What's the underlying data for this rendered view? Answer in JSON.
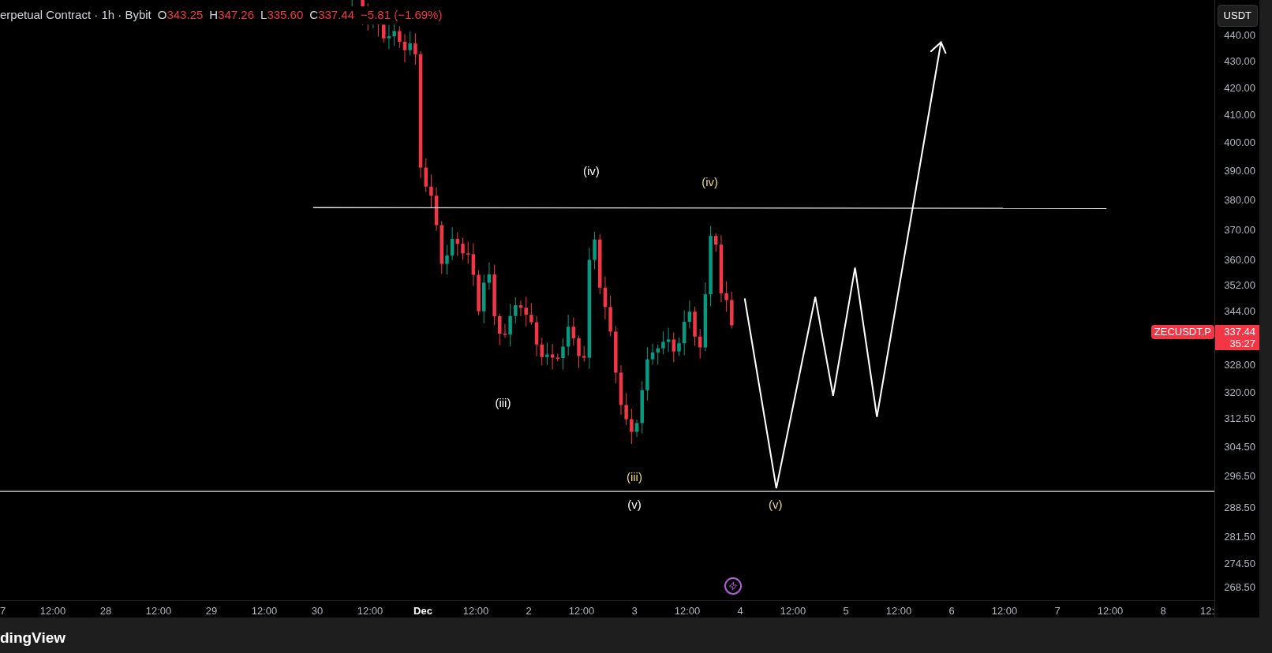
{
  "legend": {
    "symbol": "erpetual Contract · 1h · Bybit",
    "fields": [
      {
        "label": "O",
        "value": "343.25"
      },
      {
        "label": "H",
        "value": "347.26"
      },
      {
        "label": "L",
        "value": "335.60"
      },
      {
        "label": "C",
        "value": "337.44"
      }
    ],
    "change": "−5.81 (−1.69%)"
  },
  "currency_button": "USDT",
  "price_axis": [
    "440.00",
    "430.00",
    "420.00",
    "410.00",
    "400.00",
    "390.00",
    "380.00",
    "370.00",
    "360.00",
    "352.00",
    "344.00",
    "328.00",
    "320.00",
    "312.50",
    "304.50",
    "296.50",
    "288.50",
    "281.50",
    "274.50",
    "268.50"
  ],
  "price_tag": {
    "symbol": "ZECUSDT.P",
    "price": "337.44",
    "countdown": "35:27"
  },
  "time_axis": [
    {
      "label": "7",
      "kind": "day"
    },
    {
      "label": "12:00",
      "kind": "time"
    },
    {
      "label": "28",
      "kind": "day"
    },
    {
      "label": "12:00",
      "kind": "time"
    },
    {
      "label": "29",
      "kind": "day"
    },
    {
      "label": "12:00",
      "kind": "time"
    },
    {
      "label": "30",
      "kind": "day"
    },
    {
      "label": "12:00",
      "kind": "time"
    },
    {
      "label": "Dec",
      "kind": "month"
    },
    {
      "label": "12:00",
      "kind": "time"
    },
    {
      "label": "2",
      "kind": "day"
    },
    {
      "label": "12:00",
      "kind": "time"
    },
    {
      "label": "3",
      "kind": "day"
    },
    {
      "label": "12:00",
      "kind": "time"
    },
    {
      "label": "4",
      "kind": "day"
    },
    {
      "label": "12:00",
      "kind": "time"
    },
    {
      "label": "5",
      "kind": "day"
    },
    {
      "label": "12:00",
      "kind": "time"
    },
    {
      "label": "6",
      "kind": "day"
    },
    {
      "label": "12:00",
      "kind": "time"
    },
    {
      "label": "7",
      "kind": "day"
    },
    {
      "label": "12:00",
      "kind": "time"
    },
    {
      "label": "8",
      "kind": "day"
    },
    {
      "label": "12:",
      "kind": "time"
    }
  ],
  "wave_labels": [
    {
      "text": "(iv)",
      "color": "#ffffff"
    },
    {
      "text": "(iv)",
      "color": "#e8d77a"
    },
    {
      "text": "(iii)",
      "color": "#ffffff"
    },
    {
      "text": "(iii)",
      "color": "#e8d77a"
    },
    {
      "text": "(v)",
      "color": "#ffffff"
    },
    {
      "text": "(v)",
      "color": "#e8d77a"
    }
  ],
  "footer": {
    "brand": "dingView"
  }
}
